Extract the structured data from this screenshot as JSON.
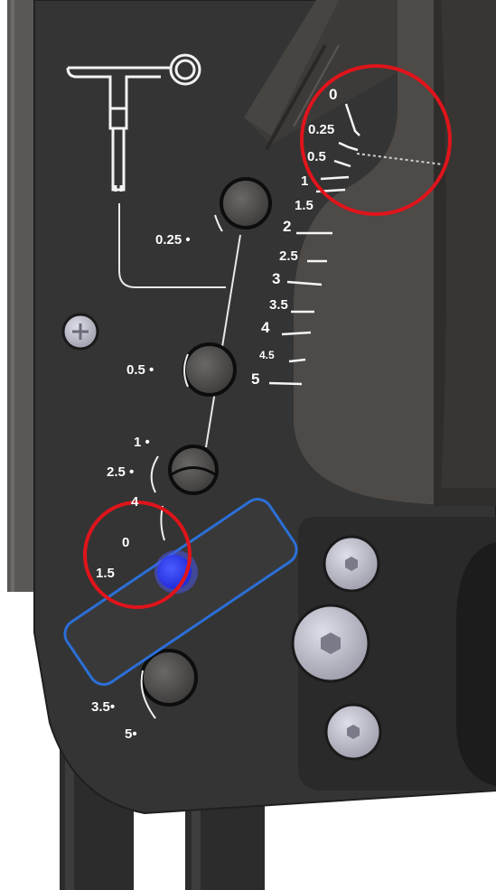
{
  "scale": {
    "marks": [
      "0",
      "0.25",
      "0.5",
      "1",
      "1.5",
      "2",
      "2.5",
      "3",
      "3.5",
      "4",
      "4.5",
      "5"
    ]
  },
  "adjuster": {
    "labels": [
      "0.25",
      "0.5",
      "1",
      "2.5",
      "4",
      "0",
      "1.5",
      "3.5",
      "5"
    ]
  },
  "colors": {
    "plate": "#343434",
    "slot": "#3a3836",
    "hole": "#545250",
    "highlight_ring": "#e0141b",
    "drag_handle_fill": "#3a3a3a",
    "drag_handle_border": "#2b6fd6",
    "drag_knob": "#2d3cff",
    "screw": "#bcbcc8",
    "text": "#ffffff"
  },
  "icons": {
    "pin_tool": "t-handle-pin-icon",
    "screw": "phillips-screw-icon",
    "hex_bolt": "hex-bolt-icon"
  }
}
